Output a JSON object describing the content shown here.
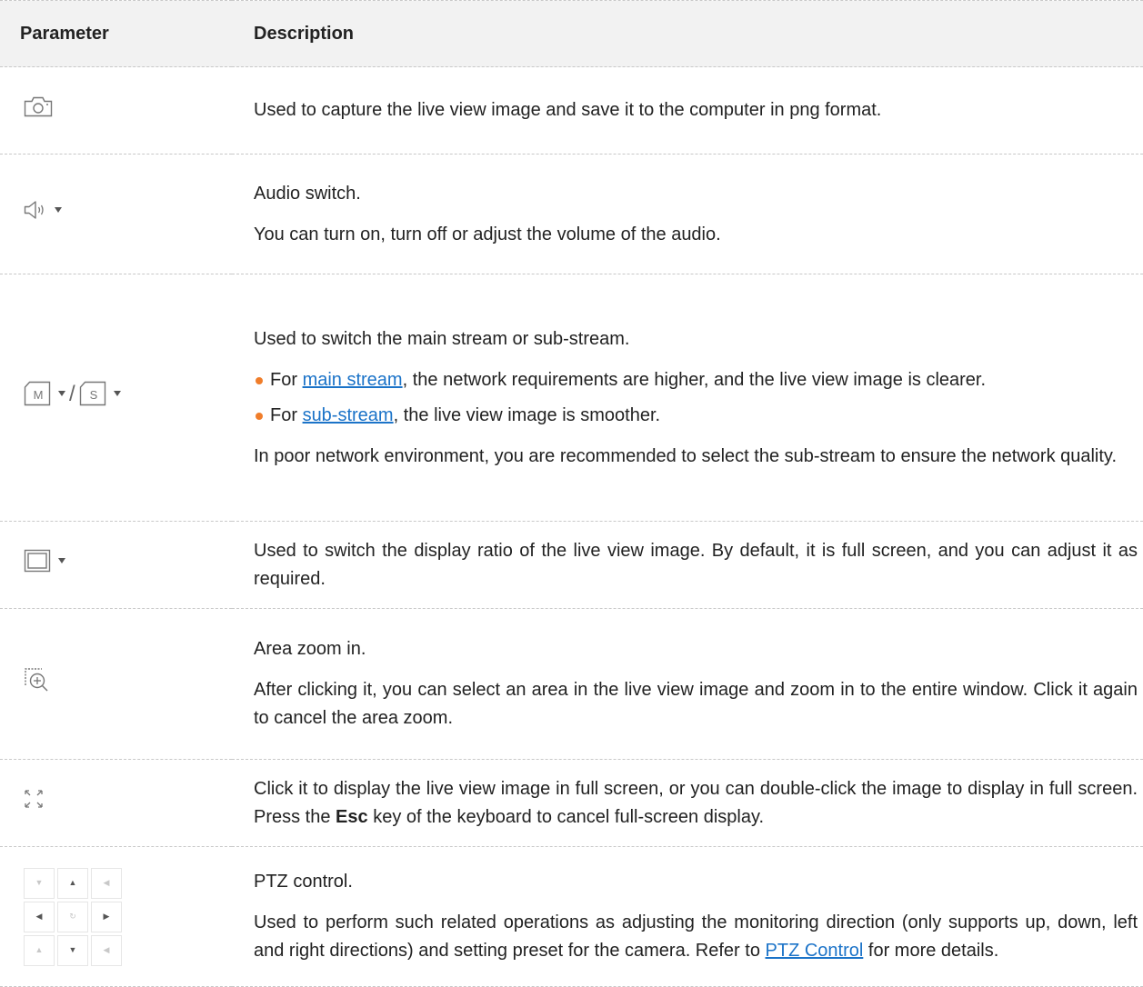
{
  "header": {
    "param": "Parameter",
    "desc": "Description"
  },
  "rows": {
    "capture": {
      "p1": "Used to capture the live view image and save it to the computer in png format."
    },
    "audio": {
      "p1": "Audio switch.",
      "p2": "You can turn on, turn off or adjust the volume of the audio."
    },
    "stream": {
      "icon_m": "M",
      "slash": "/",
      "icon_s": "S",
      "p1": "Used to switch the main stream or sub-stream.",
      "b1_pre": "For ",
      "b1_link": "main stream",
      "b1_post": ", the network requirements are higher, and the live view image is clearer.",
      "b2_pre": "For ",
      "b2_link": "sub-stream",
      "b2_post": ", the live view image is smoother.",
      "p2": "In poor network environment, you are recommended to select the sub-stream to ensure the network quality."
    },
    "ratio": {
      "p1": "Used to switch the display ratio of the live view image. By default, it is full screen, and you can adjust it as required."
    },
    "zoom": {
      "p1": "Area zoom in.",
      "p2": "After clicking it, you can select an area in the live view image and zoom in to the entire window. Click it again to cancel the area zoom."
    },
    "fullscreen": {
      "pre": "Click it to display the live view image in full screen, or you can double-click the image to display in full screen. Press the ",
      "bold": "Esc",
      "post": " key of the keyboard to cancel full-screen display."
    },
    "ptz": {
      "p1": "PTZ control.",
      "p2_pre": "Used to perform such related operations as adjusting the monitoring direction (only supports up, down, left and right directions) and setting preset for the camera. Refer to ",
      "p2_link": "PTZ Control",
      "p2_post": " for more details."
    }
  },
  "icons": {
    "camera": "camera-icon",
    "speaker": "speaker-icon",
    "main_stream": "main-stream-icon",
    "sub_stream": "sub-stream-icon",
    "ratio": "display-ratio-icon",
    "zoom": "area-zoom-icon",
    "fullscreen": "fullscreen-icon",
    "ptz": "ptz-control-icon"
  },
  "colors": {
    "bullet": "#f07d2a",
    "link": "#1b73c8",
    "header_bg": "#f2f2f2"
  }
}
